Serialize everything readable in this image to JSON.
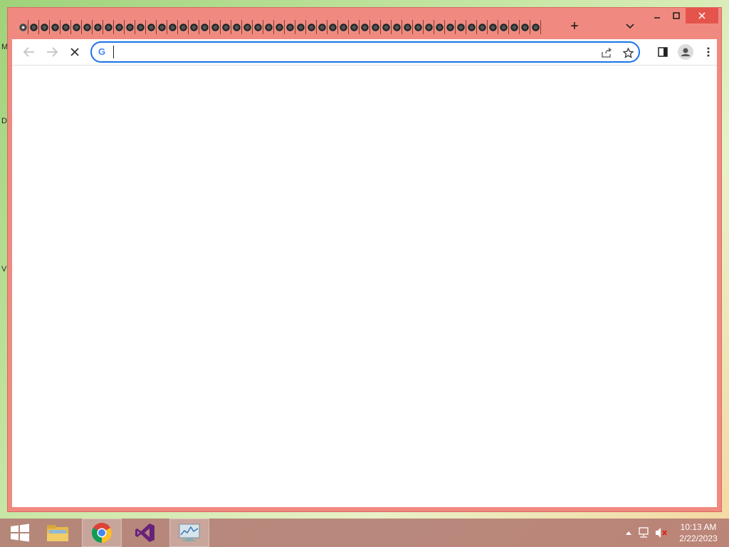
{
  "desktop": {
    "side_letters": [
      "M",
      "D",
      "V"
    ]
  },
  "browser": {
    "tab_count": 49,
    "new_tab_label": "+",
    "omnibox": {
      "value": "",
      "placeholder": ""
    },
    "colors": {
      "frame": "#f08a80",
      "omnibox_border": "#1a73e8"
    }
  },
  "taskbar": {
    "apps": [
      {
        "name": "Start"
      },
      {
        "name": "File Explorer"
      },
      {
        "name": "Google Chrome",
        "active": true
      },
      {
        "name": "Visual Studio"
      },
      {
        "name": "Performance Monitor"
      }
    ],
    "clock": {
      "time": "10:13 AM",
      "date": "2/22/2023"
    }
  }
}
